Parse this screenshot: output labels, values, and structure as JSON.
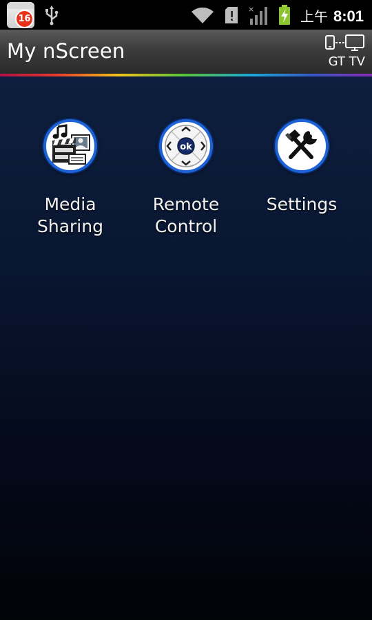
{
  "status_bar": {
    "notification_count": "16",
    "time_period": "上午",
    "time": "8:01",
    "icons": [
      "calendar-notification-icon",
      "usb-icon",
      "wifi-icon",
      "sd-card-icon",
      "signal-icon",
      "battery-charging-icon"
    ]
  },
  "title_bar": {
    "title": "My nScreen",
    "device_label": "GT TV",
    "device_icon": "phone-to-tv-icon"
  },
  "menu": {
    "items": [
      {
        "line1": "Media",
        "line2": "Sharing",
        "icon": "media-sharing-icon"
      },
      {
        "line1": "Remote",
        "line2": "Control",
        "icon": "remote-control-icon",
        "ok_label": "ok"
      },
      {
        "line1": "Settings",
        "line2": "",
        "icon": "settings-icon"
      }
    ]
  },
  "colors": {
    "accent_blue": "#1e63d6",
    "background_top": "#0d1f3e",
    "background_bottom": "#010307"
  }
}
